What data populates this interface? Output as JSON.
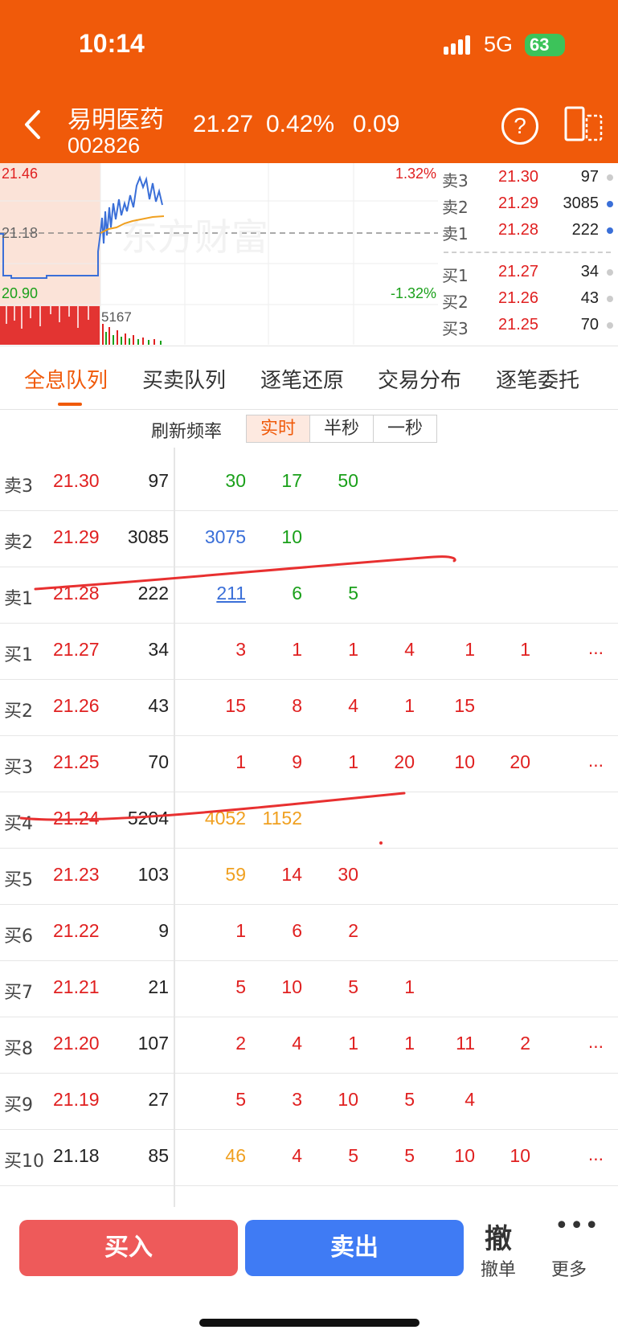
{
  "status_bar": {
    "time": "10:14",
    "network": "5G",
    "battery": "63"
  },
  "header": {
    "stock_name": "易明医药",
    "stock_code": "002826",
    "price": "21.27",
    "change_pct": "0.42%",
    "change": "0.09",
    "colors": {
      "background": "#f05a0a",
      "text": "#ffffff"
    }
  },
  "chart": {
    "high_label": "21.46",
    "mid_label": "21.18",
    "low_label": "20.90",
    "pct_up": "1.32%",
    "pct_down": "-1.32%",
    "volume_label": "5167",
    "watermark": "东方财富"
  },
  "book": {
    "asks": [
      {
        "label": "卖3",
        "price": "21.30",
        "volume": "97",
        "dot": "#cccccc"
      },
      {
        "label": "卖2",
        "price": "21.29",
        "volume": "3085",
        "dot": "#3a6fd8"
      },
      {
        "label": "卖1",
        "price": "21.28",
        "volume": "222",
        "dot": "#3a6fd8"
      }
    ],
    "bids": [
      {
        "label": "买1",
        "price": "21.27",
        "volume": "34",
        "dot": "#cccccc"
      },
      {
        "label": "买2",
        "price": "21.26",
        "volume": "43",
        "dot": "#cccccc"
      },
      {
        "label": "买3",
        "price": "21.25",
        "volume": "70",
        "dot": "#cccccc"
      }
    ]
  },
  "tabs": [
    "全息队列",
    "买卖队列",
    "逐笔还原",
    "交易分布",
    "逐笔委托"
  ],
  "refresh": {
    "label": "刷新频率",
    "options": [
      "实时",
      "半秒",
      "一秒"
    ],
    "selected": "实时"
  },
  "queue": {
    "rows": [
      {
        "level": "卖3",
        "price": "21.30",
        "volume": "97",
        "queue": [
          {
            "v": "30",
            "c": "green"
          },
          {
            "v": "17",
            "c": "green"
          },
          {
            "v": "50",
            "c": "green"
          }
        ],
        "more": ""
      },
      {
        "level": "卖2",
        "price": "21.29",
        "volume": "3085",
        "queue": [
          {
            "v": "3075",
            "c": "blue"
          },
          {
            "v": "10",
            "c": "green"
          }
        ],
        "more": ""
      },
      {
        "level": "卖1",
        "price": "21.28",
        "volume": "222",
        "queue": [
          {
            "v": "211",
            "c": "blue",
            "u": true
          },
          {
            "v": "6",
            "c": "green"
          },
          {
            "v": "5",
            "c": "green"
          }
        ],
        "more": ""
      },
      {
        "level": "买1",
        "price": "21.27",
        "volume": "34",
        "queue": [
          {
            "v": "3",
            "c": "red"
          },
          {
            "v": "1",
            "c": "red"
          },
          {
            "v": "1",
            "c": "red"
          },
          {
            "v": "4",
            "c": "red"
          },
          {
            "v": "1",
            "c": "red"
          },
          {
            "v": "1",
            "c": "red"
          }
        ],
        "more": "..."
      },
      {
        "level": "买2",
        "price": "21.26",
        "volume": "43",
        "queue": [
          {
            "v": "15",
            "c": "red"
          },
          {
            "v": "8",
            "c": "red"
          },
          {
            "v": "4",
            "c": "red"
          },
          {
            "v": "1",
            "c": "red"
          },
          {
            "v": "15",
            "c": "red"
          }
        ],
        "more": ""
      },
      {
        "level": "买3",
        "price": "21.25",
        "volume": "70",
        "queue": [
          {
            "v": "1",
            "c": "red"
          },
          {
            "v": "9",
            "c": "red"
          },
          {
            "v": "1",
            "c": "red"
          },
          {
            "v": "20",
            "c": "red"
          },
          {
            "v": "10",
            "c": "red"
          },
          {
            "v": "20",
            "c": "red"
          }
        ],
        "more": "..."
      },
      {
        "level": "买4",
        "price": "21.24",
        "volume": "5204",
        "queue": [
          {
            "v": "4052",
            "c": "orange"
          },
          {
            "v": "1152",
            "c": "orange"
          }
        ],
        "more": ""
      },
      {
        "level": "买5",
        "price": "21.23",
        "volume": "103",
        "queue": [
          {
            "v": "59",
            "c": "orange"
          },
          {
            "v": "14",
            "c": "red"
          },
          {
            "v": "30",
            "c": "red"
          }
        ],
        "more": ""
      },
      {
        "level": "买6",
        "price": "21.22",
        "volume": "9",
        "queue": [
          {
            "v": "1",
            "c": "red"
          },
          {
            "v": "6",
            "c": "red"
          },
          {
            "v": "2",
            "c": "red"
          }
        ],
        "more": ""
      },
      {
        "level": "买7",
        "price": "21.21",
        "volume": "21",
        "queue": [
          {
            "v": "5",
            "c": "red"
          },
          {
            "v": "10",
            "c": "red"
          },
          {
            "v": "5",
            "c": "red"
          },
          {
            "v": "1",
            "c": "red"
          }
        ],
        "more": ""
      },
      {
        "level": "买8",
        "price": "21.20",
        "volume": "107",
        "queue": [
          {
            "v": "2",
            "c": "red"
          },
          {
            "v": "4",
            "c": "red"
          },
          {
            "v": "1",
            "c": "red"
          },
          {
            "v": "1",
            "c": "red"
          },
          {
            "v": "11",
            "c": "red"
          },
          {
            "v": "2",
            "c": "red"
          }
        ],
        "more": "..."
      },
      {
        "level": "买9",
        "price": "21.19",
        "volume": "27",
        "queue": [
          {
            "v": "5",
            "c": "red"
          },
          {
            "v": "3",
            "c": "red"
          },
          {
            "v": "10",
            "c": "red"
          },
          {
            "v": "5",
            "c": "red"
          },
          {
            "v": "4",
            "c": "red"
          }
        ],
        "more": ""
      },
      {
        "level": "买10",
        "price": "21.18",
        "volume": "85",
        "price_black": true,
        "queue": [
          {
            "v": "46",
            "c": "orange"
          },
          {
            "v": "4",
            "c": "red"
          },
          {
            "v": "5",
            "c": "red"
          },
          {
            "v": "5",
            "c": "red"
          },
          {
            "v": "10",
            "c": "red"
          },
          {
            "v": "10",
            "c": "red"
          }
        ],
        "more": "..."
      }
    ],
    "colors": {
      "red": "#e02020",
      "green": "#1aa01a",
      "blue": "#3a6fd8",
      "orange": "#f0a020"
    }
  },
  "bottom": {
    "buy": "买入",
    "sell": "卖出",
    "cancel_icon": "撤",
    "cancel": "撤单",
    "more_icon": "•••",
    "more": "更多"
  }
}
